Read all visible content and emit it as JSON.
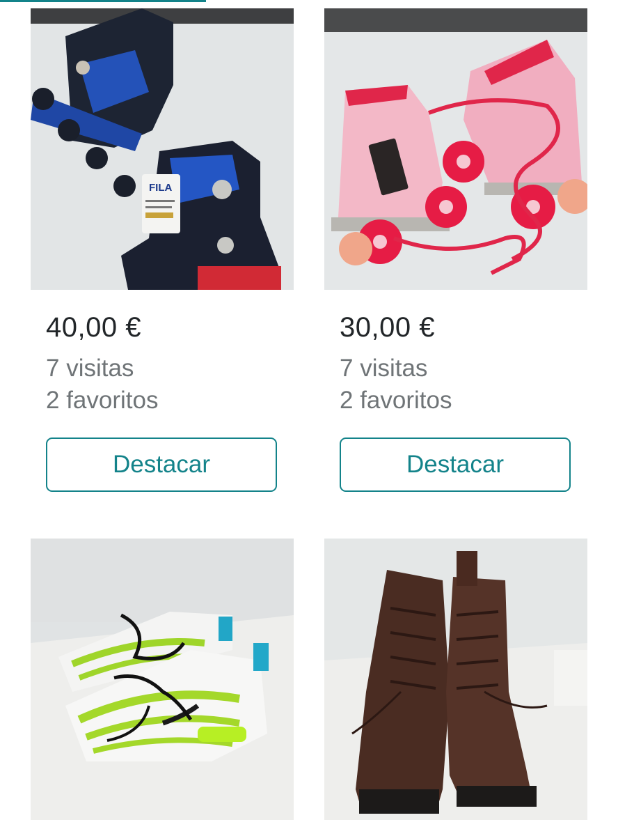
{
  "listings": [
    {
      "photo_icon": "inline-skates-photo",
      "price": "40,00 €",
      "visits": "7 visitas",
      "favorites": "2 favoritos",
      "promote_label": "Destacar"
    },
    {
      "photo_icon": "roller-skates-photo",
      "price": "30,00 €",
      "visits": "7 visitas",
      "favorites": "2 favoritos",
      "promote_label": "Destacar"
    },
    {
      "photo_icon": "sneakers-photo"
    },
    {
      "photo_icon": "boots-photo"
    }
  ],
  "colors": {
    "accent": "#13838a",
    "price_text": "#222629",
    "secondary_text": "#6f7477"
  }
}
